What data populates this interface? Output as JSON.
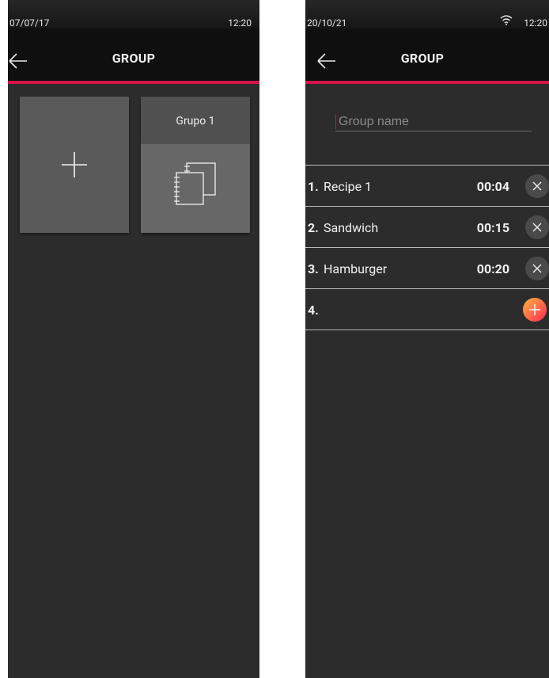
{
  "left_screen": {
    "status": {
      "date": "07/07/17",
      "time": "12:20"
    },
    "header": {
      "title": "GROUP"
    },
    "tiles": [
      {
        "type": "add"
      },
      {
        "type": "group",
        "label": "Grupo 1"
      }
    ]
  },
  "right_screen": {
    "status": {
      "date": "20/10/21",
      "time": "12:20"
    },
    "header": {
      "title": "GROUP"
    },
    "name_field": {
      "placeholder": "Group name",
      "value": ""
    },
    "recipes": [
      {
        "index": "1.",
        "name": "Recipe 1",
        "duration": "00:04"
      },
      {
        "index": "2.",
        "name": "Sandwich",
        "duration": "00:15"
      },
      {
        "index": "3.",
        "name": "Hamburger",
        "duration": "00:20"
      }
    ],
    "new_row": {
      "index": "4."
    }
  },
  "colors": {
    "accent": "#d4144a",
    "background": "#2c2c2c",
    "header": "#0f0f0f",
    "add_gradient": [
      "#ffb33c",
      "#ff2a56"
    ]
  }
}
